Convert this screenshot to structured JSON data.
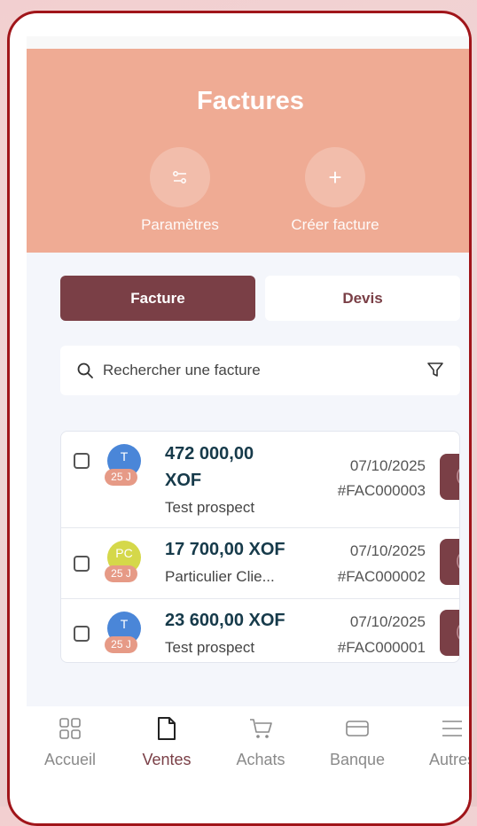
{
  "header": {
    "title": "Factures",
    "actions": [
      {
        "label": "Paramètres",
        "icon": "sliders-icon"
      },
      {
        "label": "Créer facture",
        "icon": "plus-icon"
      }
    ]
  },
  "tabs": [
    {
      "label": "Facture",
      "active": true
    },
    {
      "label": "Devis",
      "active": false
    }
  ],
  "search": {
    "placeholder": "Rechercher une facture",
    "value": ""
  },
  "invoices": [
    {
      "avatar": "T",
      "days": "25 J",
      "amount_line1": "472 000,00",
      "amount_line2": "XOF",
      "client": "Test prospect",
      "date": "07/10/2025",
      "number": "#FAC000003",
      "avatar_color": "#4a86d8"
    },
    {
      "avatar": "PC",
      "days": "25 J",
      "amount_line1": "17 700,00 XOF",
      "amount_line2": "",
      "client": "Particulier Clie...",
      "date": "07/10/2025",
      "number": "#FAC000002",
      "avatar_color": "#d5d84a"
    },
    {
      "avatar": "T",
      "days": "25 J",
      "amount_line1": "23 600,00 XOF",
      "amount_line2": "",
      "client": "Test prospect",
      "date": "07/10/2025",
      "number": "#FAC000001",
      "avatar_color": "#4a86d8"
    }
  ],
  "nav": [
    {
      "label": "Accueil",
      "icon": "grid-icon",
      "active": false
    },
    {
      "label": "Ventes",
      "icon": "document-icon",
      "active": true
    },
    {
      "label": "Achats",
      "icon": "cart-icon",
      "active": false
    },
    {
      "label": "Banque",
      "icon": "card-icon",
      "active": false
    },
    {
      "label": "Autres",
      "icon": "menu-icon",
      "active": false
    }
  ],
  "colors": {
    "header": "#efab94",
    "primary": "#7a3f46",
    "amount": "#163a4a",
    "badge": "#e69a86",
    "frame": "#a0151a"
  }
}
